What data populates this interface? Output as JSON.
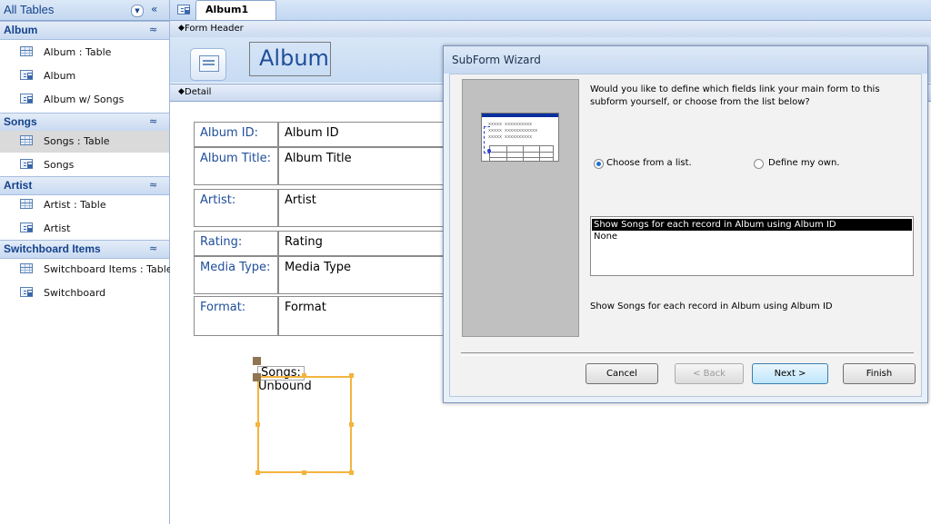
{
  "nav": {
    "title": "All Tables",
    "groups": [
      {
        "label": "Album",
        "items": [
          {
            "label": "Album : Table",
            "icon": "table-icon"
          },
          {
            "label": "Album",
            "icon": "form-icon"
          },
          {
            "label": "Album w/ Songs",
            "icon": "form-icon"
          }
        ]
      },
      {
        "label": "Songs",
        "items": [
          {
            "label": "Songs : Table",
            "icon": "table-icon"
          },
          {
            "label": "Songs",
            "icon": "form-icon"
          }
        ]
      },
      {
        "label": "Artist",
        "items": [
          {
            "label": "Artist : Table",
            "icon": "table-icon"
          },
          {
            "label": "Artist",
            "icon": "form-icon"
          }
        ]
      },
      {
        "label": "Switchboard Items",
        "items": [
          {
            "label": "Switchboard Items : Table",
            "icon": "table-icon"
          },
          {
            "label": "Switchboard",
            "icon": "form-icon"
          }
        ]
      }
    ]
  },
  "document": {
    "tab_label": "Album1",
    "form_header_label": "Form Header",
    "header_title": "Album",
    "detail_label": "Detail",
    "fields": [
      {
        "label": "Album ID:",
        "value": "Album ID"
      },
      {
        "label": "Album Title:",
        "value": "Album Title"
      },
      {
        "label": "Artist:",
        "value": "Artist"
      },
      {
        "label": "Rating:",
        "value": "Rating"
      },
      {
        "label": "Media Type:",
        "value": "Media Type"
      },
      {
        "label": "Format:",
        "value": "Format"
      }
    ],
    "subform_label": "Songs:",
    "subform_content": "Unbound"
  },
  "wizard": {
    "title": "SubForm Wizard",
    "question": "Would you like to define which fields link your main form to this subform yourself, or choose from the list below?",
    "radio_choose": "Choose from a list.",
    "radio_define": "Define my own.",
    "list_options": [
      "Show Songs for each record in Album using Album ID",
      "None"
    ],
    "selected_description": "Show Songs for each record in Album using Album ID",
    "buttons": {
      "cancel": "Cancel",
      "back": "< Back",
      "next": "Next >",
      "finish": "Finish"
    },
    "illustration_text": "xxxxx xxxxxxxxxx\nxxxxx xxxxxxxxxxxx\nxxxxx xxxxxxxxxx"
  },
  "colors": {
    "accent_blue": "#1f4e9b",
    "ribbon_blue": "#c6dbf3",
    "selection_handle": "#f4b43e",
    "list_selection": "#000000"
  }
}
